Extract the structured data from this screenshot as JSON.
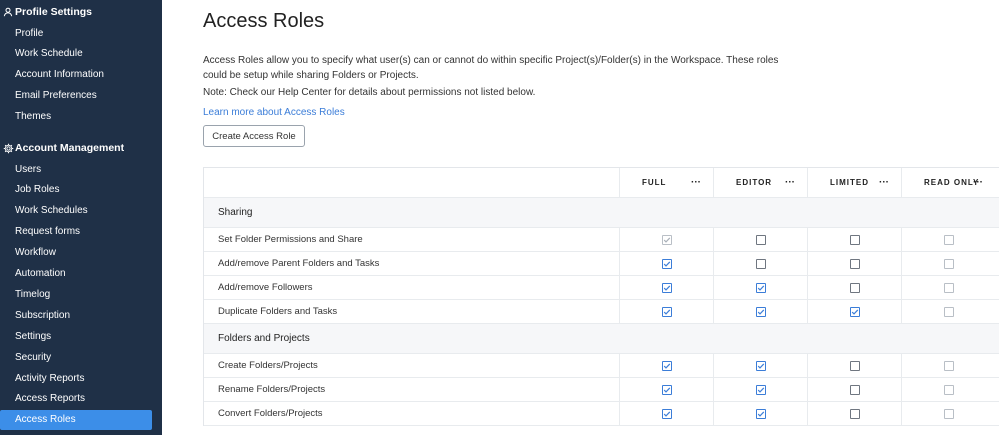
{
  "sidebar": {
    "profile_settings": {
      "header": "Profile Settings",
      "icon": "user-icon",
      "items": [
        "Profile",
        "Work Schedule",
        "Account Information",
        "Email Preferences",
        "Themes"
      ]
    },
    "account_management": {
      "header": "Account Management",
      "icon": "gear-icon",
      "items": [
        "Users",
        "Job Roles",
        "Work Schedules",
        "Request forms",
        "Workflow",
        "Automation",
        "Timelog",
        "Subscription",
        "Settings",
        "Security",
        "Activity Reports",
        "Access Reports",
        "Access Roles"
      ],
      "active": "Access Roles"
    }
  },
  "main": {
    "title": "Access Roles",
    "description": "Access Roles allow you to specify what user(s) can or cannot do within specific Project(s)/Folder(s) in the Workspace. These roles could be setup while sharing Folders or Projects.",
    "note": "Note: Check our Help Center for details about permissions not listed below.",
    "learn_more": "Learn more about Access Roles",
    "create_button": "Create Access Role"
  },
  "table": {
    "columns": [
      "FULL",
      "EDITOR",
      "LIMITED",
      "READ ONLY"
    ],
    "more_label": "···",
    "groups": [
      {
        "name": "Sharing",
        "rows": [
          {
            "label": "Set Folder Permissions and Share",
            "values": [
              "checked-disabled",
              "unchecked",
              "unchecked",
              "unchecked-disabled"
            ]
          },
          {
            "label": "Add/remove Parent Folders and Tasks",
            "values": [
              "checked",
              "unchecked",
              "unchecked",
              "unchecked-disabled"
            ]
          },
          {
            "label": "Add/remove Followers",
            "values": [
              "checked",
              "checked",
              "unchecked",
              "unchecked-disabled"
            ]
          },
          {
            "label": "Duplicate Folders and Tasks",
            "values": [
              "checked",
              "checked",
              "checked",
              "unchecked-disabled"
            ]
          }
        ]
      },
      {
        "name": "Folders and Projects",
        "rows": [
          {
            "label": "Create Folders/Projects",
            "values": [
              "checked",
              "checked",
              "unchecked",
              "unchecked-disabled"
            ]
          },
          {
            "label": "Rename Folders/Projects",
            "values": [
              "checked",
              "checked",
              "unchecked",
              "unchecked-disabled"
            ]
          },
          {
            "label": "Convert Folders/Projects",
            "values": [
              "checked",
              "checked",
              "unchecked",
              "unchecked-disabled"
            ]
          }
        ]
      }
    ]
  },
  "colors": {
    "sidebar_bg": "#1f3047",
    "active_item": "#3c8ee8",
    "link": "#3b7dd8",
    "check": "#3b7dd8"
  }
}
